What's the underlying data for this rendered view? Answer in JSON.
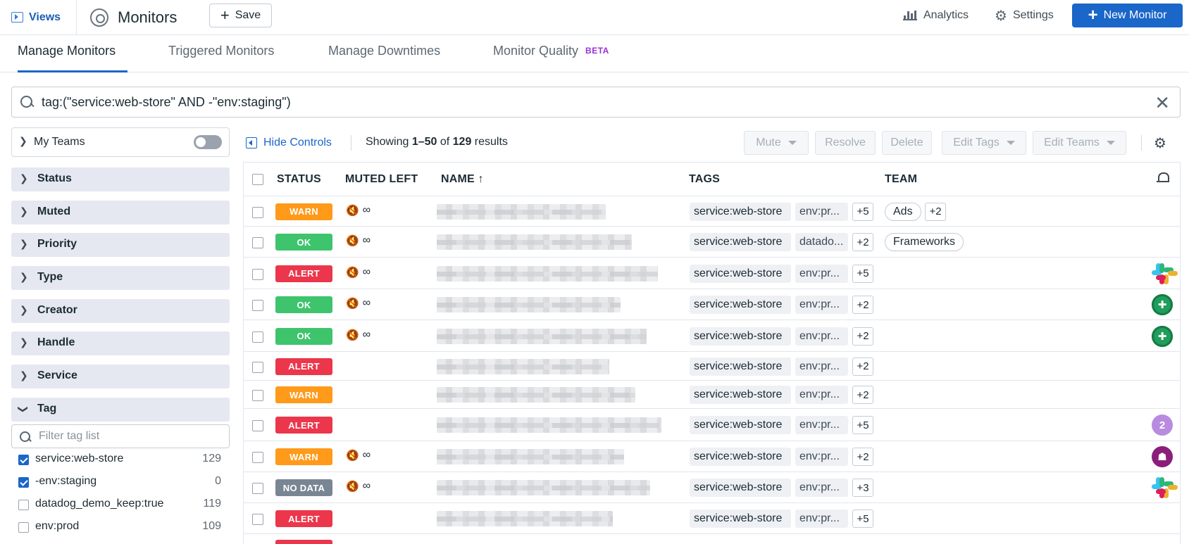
{
  "topbar": {
    "views_label": "Views",
    "title": "Monitors",
    "save_label": "Save",
    "analytics_label": "Analytics",
    "settings_label": "Settings",
    "new_monitor_label": "New Monitor"
  },
  "tabs": [
    {
      "label": "Manage Monitors",
      "active": true
    },
    {
      "label": "Triggered Monitors",
      "active": false
    },
    {
      "label": "Manage Downtimes",
      "active": false
    },
    {
      "label": "Monitor Quality",
      "active": false,
      "badge": "BETA"
    }
  ],
  "search": {
    "query": "tag:(\"service:web-store\" AND -\"env:staging\")"
  },
  "sidebar": {
    "my_teams_label": "My Teams",
    "facets": [
      "Status",
      "Muted",
      "Priority",
      "Type",
      "Creator",
      "Handle",
      "Service",
      "Tag"
    ],
    "tag_filter_placeholder": "Filter tag list",
    "tags": [
      {
        "label": "service:web-store",
        "count": "129",
        "checked": true
      },
      {
        "label": "-env:staging",
        "count": "0",
        "checked": true
      },
      {
        "label": "datadog_demo_keep:true",
        "count": "119",
        "checked": false
      },
      {
        "label": "env:prod",
        "count": "109",
        "checked": false
      }
    ]
  },
  "controls": {
    "hide_controls_label": "Hide Controls",
    "showing_prefix": "Showing ",
    "showing_range": "1–50",
    "showing_of": " of ",
    "showing_total": "129",
    "showing_suffix": " results",
    "mute_label": "Mute",
    "resolve_label": "Resolve",
    "delete_label": "Delete",
    "edit_tags_label": "Edit Tags",
    "edit_teams_label": "Edit Teams"
  },
  "table": {
    "columns": {
      "status": "STATUS",
      "muted_left": "MUTED LEFT",
      "name": "NAME ↑",
      "tags": "TAGS",
      "team": "TEAM"
    },
    "rows": [
      {
        "status": "WARN",
        "muted": "∞",
        "tag1": "service:web-store",
        "tag2": "env:pr...",
        "more": "+5",
        "teams": [
          "Ads"
        ],
        "team_more": "+2",
        "icon": ""
      },
      {
        "status": "OK",
        "muted": "∞",
        "tag1": "service:web-store",
        "tag2": "datado...",
        "more": "+2",
        "teams": [
          "Frameworks"
        ],
        "team_more": "",
        "icon": ""
      },
      {
        "status": "ALERT",
        "muted": "∞",
        "tag1": "service:web-store",
        "tag2": "env:pr...",
        "more": "+5",
        "teams": [],
        "team_more": "",
        "icon": "slack"
      },
      {
        "status": "OK",
        "muted": "∞",
        "tag1": "service:web-store",
        "tag2": "env:pr...",
        "more": "+2",
        "teams": [],
        "team_more": "",
        "icon": "green-avatar"
      },
      {
        "status": "OK",
        "muted": "∞",
        "tag1": "service:web-store",
        "tag2": "env:pr...",
        "more": "+2",
        "teams": [],
        "team_more": "",
        "icon": "green-avatar"
      },
      {
        "status": "ALERT",
        "muted": "",
        "tag1": "service:web-store",
        "tag2": "env:pr...",
        "more": "+2",
        "teams": [],
        "team_more": "",
        "icon": ""
      },
      {
        "status": "WARN",
        "muted": "",
        "tag1": "service:web-store",
        "tag2": "env:pr...",
        "more": "+2",
        "teams": [],
        "team_more": "",
        "icon": ""
      },
      {
        "status": "ALERT",
        "muted": "",
        "tag1": "service:web-store",
        "tag2": "env:pr...",
        "more": "+5",
        "teams": [],
        "team_more": "",
        "icon": "count-2",
        "icon_text": "2"
      },
      {
        "status": "WARN",
        "muted": "∞",
        "tag1": "service:web-store",
        "tag2": "env:pr...",
        "more": "+2",
        "teams": [],
        "team_more": "",
        "icon": "purple-avatar"
      },
      {
        "status": "NO DATA",
        "muted": "∞",
        "tag1": "service:web-store",
        "tag2": "env:pr...",
        "more": "+3",
        "teams": [],
        "team_more": "",
        "icon": "slack"
      },
      {
        "status": "ALERT",
        "muted": "",
        "tag1": "service:web-store",
        "tag2": "env:pr...",
        "more": "+5",
        "teams": [],
        "team_more": "",
        "icon": ""
      }
    ]
  },
  "colors": {
    "accent": "#1a66c9",
    "warn": "#ff9a1a",
    "ok": "#3ec46d",
    "alert": "#eb364b",
    "nodata": "#7a8594",
    "beta": "#9a2fd8",
    "muted_icon": "#f08a24"
  },
  "icons": {
    "views": "views-panel-icon",
    "monitors": "monitors-icon",
    "save": "plus-icon",
    "analytics": "bar-chart-icon",
    "settings": "gear-icon",
    "new_monitor": "plus-icon",
    "search": "search-icon",
    "clear": "close-icon",
    "muted": "speaker-muted-icon",
    "team_notifications": "bell-icon"
  }
}
